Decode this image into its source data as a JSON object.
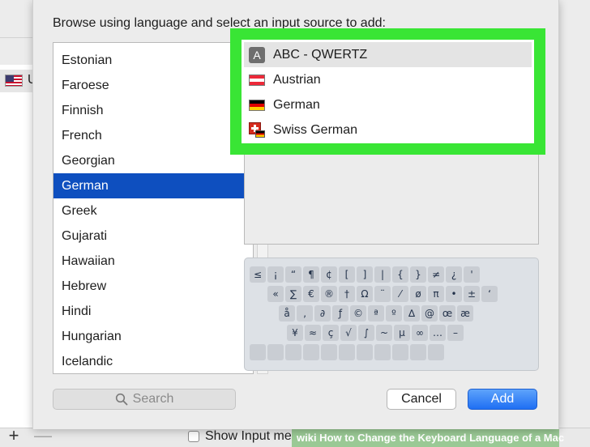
{
  "background": {
    "side_letter": "U",
    "show_input_menu_label": "Show Input me",
    "plus_label": "+",
    "minus_label": "—",
    "watermark": "wiki How to Change the Keyboard Language of a Mac"
  },
  "sheet": {
    "title": "Browse using language and select an input source to add:",
    "languages": [
      {
        "label": "Estonian",
        "selected": false
      },
      {
        "label": "Faroese",
        "selected": false
      },
      {
        "label": "Finnish",
        "selected": false
      },
      {
        "label": "French",
        "selected": false
      },
      {
        "label": "Georgian",
        "selected": false
      },
      {
        "label": "German",
        "selected": true
      },
      {
        "label": "Greek",
        "selected": false
      },
      {
        "label": "Gujarati",
        "selected": false
      },
      {
        "label": "Hawaiian",
        "selected": false
      },
      {
        "label": "Hebrew",
        "selected": false
      },
      {
        "label": "Hindi",
        "selected": false
      },
      {
        "label": "Hungarian",
        "selected": false
      },
      {
        "label": "Icelandic",
        "selected": false
      }
    ],
    "input_sources": [
      {
        "label": "ABC - QWERTZ",
        "icon": "abc-keyboard-icon",
        "icon_text": "A",
        "selected": true
      },
      {
        "label": "Austrian",
        "icon": "austria-flag-icon",
        "selected": false
      },
      {
        "label": "German",
        "icon": "germany-flag-icon",
        "selected": false
      },
      {
        "label": "Swiss German",
        "icon": "switzerland-flag-icon",
        "selected": false
      }
    ],
    "keyboard_rows": [
      [
        "≤",
        "¡",
        "“",
        "¶",
        "¢",
        "[",
        "]",
        "|",
        "{",
        "}",
        "≠",
        "¿",
        "'"
      ],
      [
        "«",
        "∑",
        "€",
        "®",
        "†",
        "Ω",
        "¨",
        "⁄",
        "ø",
        "π",
        "•",
        "±",
        "‘"
      ],
      [
        "å",
        "‚",
        "∂",
        "ƒ",
        "©",
        "ª",
        "º",
        "∆",
        "@",
        "œ",
        "æ"
      ],
      [
        "¥",
        "≈",
        "ç",
        "√",
        "∫",
        "~",
        "µ",
        "∞",
        "…",
        "–"
      ],
      [
        "",
        "",
        "",
        "",
        "",
        "",
        "",
        "",
        "",
        "",
        ""
      ]
    ],
    "search_placeholder": "Search",
    "cancel_label": "Cancel",
    "add_label": "Add",
    "colors": {
      "selection_blue": "#0e4fbf",
      "highlight_green": "#39e535",
      "add_button_blue": "#1f6ff3"
    }
  }
}
